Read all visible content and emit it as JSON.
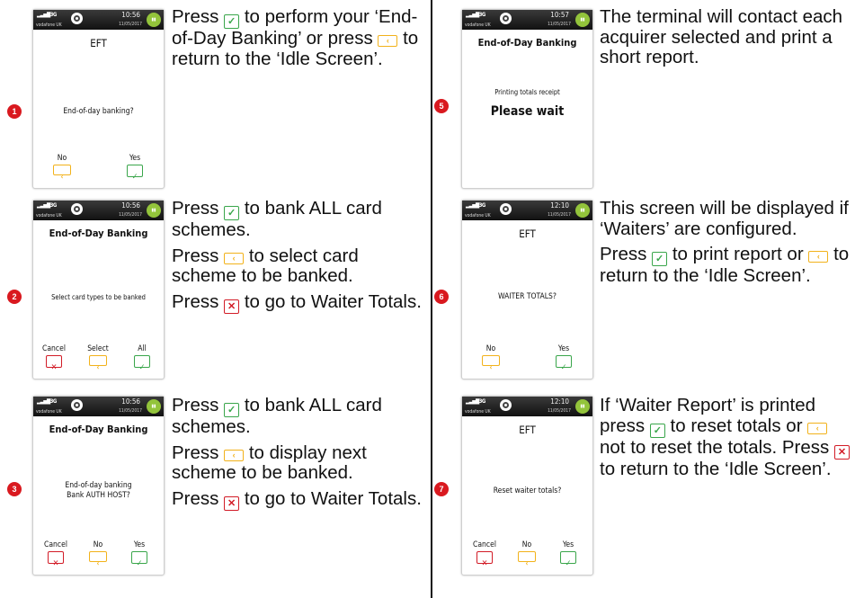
{
  "terminals": {
    "s1": {
      "operator": "vodafone UK",
      "time": "10:56",
      "date": "11/05/2017",
      "title": "EFT",
      "message": "End-of-day banking?",
      "keys": {
        "no": "No",
        "yes": "Yes"
      }
    },
    "s2": {
      "operator": "vodafone UK",
      "time": "10:56",
      "date": "11/05/2017",
      "title": "End-of-Day Banking",
      "message": "Select card types to be banked",
      "keys": {
        "cancel": "Cancel",
        "select": "Select",
        "all": "All"
      }
    },
    "s3": {
      "operator": "vodafone UK",
      "time": "10:56",
      "date": "11/05/2017",
      "title": "End-of-Day Banking",
      "message_line1": "End-of-day banking",
      "message_line2": "Bank AUTH HOST?",
      "keys": {
        "cancel": "Cancel",
        "no": "No",
        "yes": "Yes"
      }
    },
    "s5": {
      "operator": "vodafone UK",
      "time": "10:57",
      "date": "11/05/2017",
      "title": "End-of-Day Banking",
      "message": "Printing totals receipt",
      "big": "Please wait"
    },
    "s6": {
      "operator": "vodafone UK",
      "time": "12:10",
      "date": "11/05/2017",
      "title": "EFT",
      "message": "WAITER TOTALS?",
      "keys": {
        "no": "No",
        "yes": "Yes"
      }
    },
    "s7": {
      "operator": "vodafone UK",
      "time": "12:10",
      "date": "11/05/2017",
      "title": "EFT",
      "message": "Reset waiter totals?",
      "keys": {
        "cancel": "Cancel",
        "no": "No",
        "yes": "Yes"
      }
    }
  },
  "steps": {
    "s1": "1",
    "s2": "2",
    "s3": "3",
    "s5": "5",
    "s6": "6",
    "s7": "7"
  },
  "descriptions": {
    "d1": {
      "a": "Press",
      "b": "to perform your ‘End-of-Day Banking’ or press",
      "c": "to return to the ‘Idle Screen’."
    },
    "d2": {
      "p1a": "Press",
      "p1b": "to bank ALL card schemes.",
      "p2a": "Press",
      "p2b": "to select card scheme to be banked.",
      "p3a": "Press",
      "p3b": "to go to Waiter Totals."
    },
    "d3": {
      "p1a": "Press",
      "p1b": "to bank ALL card schemes.",
      "p2a": "Press",
      "p2b": "to display next scheme to be banked.",
      "p3a": "Press",
      "p3b": "to go to Waiter Totals."
    },
    "d5": {
      "text": "The terminal will contact each acquirer selected and print a short report."
    },
    "d6": {
      "p1": "This screen will be displayed if ‘Waiters’ are configured.",
      "p2a": "Press",
      "p2b": "to print report or",
      "p2c": "to return to the ‘Idle Screen’."
    },
    "d7": {
      "a": "If ‘Waiter Report’ is printed press",
      "b": "to reset totals or",
      "c": "not to reset the totals. Press",
      "d": "to return to the ‘Idle Screen’."
    }
  },
  "icons": {
    "green_key": "check-key-icon",
    "yellow_key": "back-key-icon",
    "red_key": "cancel-key-icon"
  },
  "colors": {
    "badge": "#d9191f",
    "green_key": "#3aa64b",
    "yellow_key": "#f2b21b",
    "red_key": "#d21c27",
    "battery": "#93c43b"
  }
}
